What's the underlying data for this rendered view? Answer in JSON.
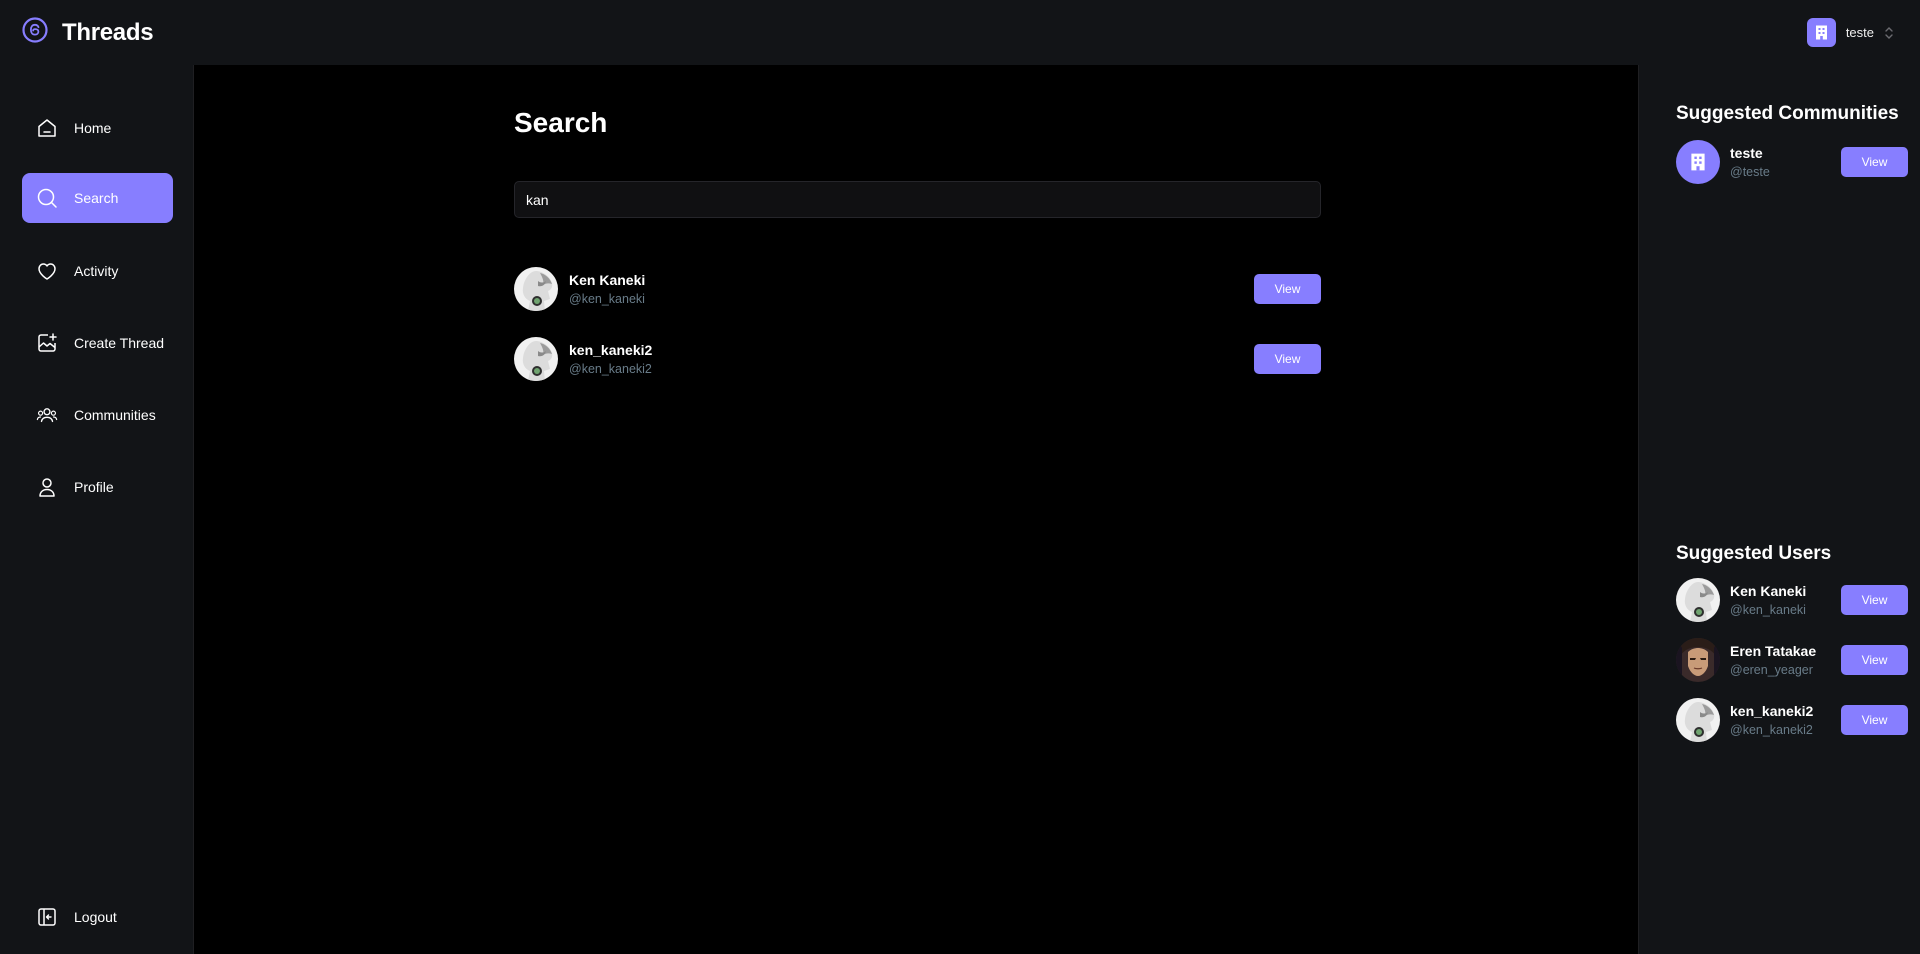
{
  "header": {
    "brand_title": "Threads",
    "org_name": "teste",
    "logo_icon": "threads-logo-icon",
    "accent_color": "#877eff"
  },
  "sidebar": {
    "items": [
      {
        "label": "Home",
        "icon": "home-icon",
        "active": false
      },
      {
        "label": "Search",
        "icon": "search-icon",
        "active": true
      },
      {
        "label": "Activity",
        "icon": "heart-icon",
        "active": false
      },
      {
        "label": "Create Thread",
        "icon": "create-thread-icon",
        "active": false
      },
      {
        "label": "Communities",
        "icon": "users-icon",
        "active": false
      },
      {
        "label": "Profile",
        "icon": "user-icon",
        "active": false
      }
    ],
    "logout_label": "Logout"
  },
  "main": {
    "title": "Search",
    "search_value": "kan",
    "results": [
      {
        "name": "Ken Kaneki",
        "handle": "@ken_kaneki",
        "button": "View"
      },
      {
        "name": "ken_kaneki2",
        "handle": "@ken_kaneki2",
        "button": "View"
      }
    ]
  },
  "right": {
    "communities_heading": "Suggested Communities",
    "communities": [
      {
        "name": "teste",
        "handle": "@teste",
        "button": "View"
      }
    ],
    "users_heading": "Suggested Users",
    "users": [
      {
        "name": "Ken Kaneki",
        "handle": "@ken_kaneki",
        "button": "View"
      },
      {
        "name": "Eren Tatakae",
        "handle": "@eren_yeager",
        "button": "View"
      },
      {
        "name": "ken_kaneki2",
        "handle": "@ken_kaneki2",
        "button": "View"
      }
    ]
  }
}
